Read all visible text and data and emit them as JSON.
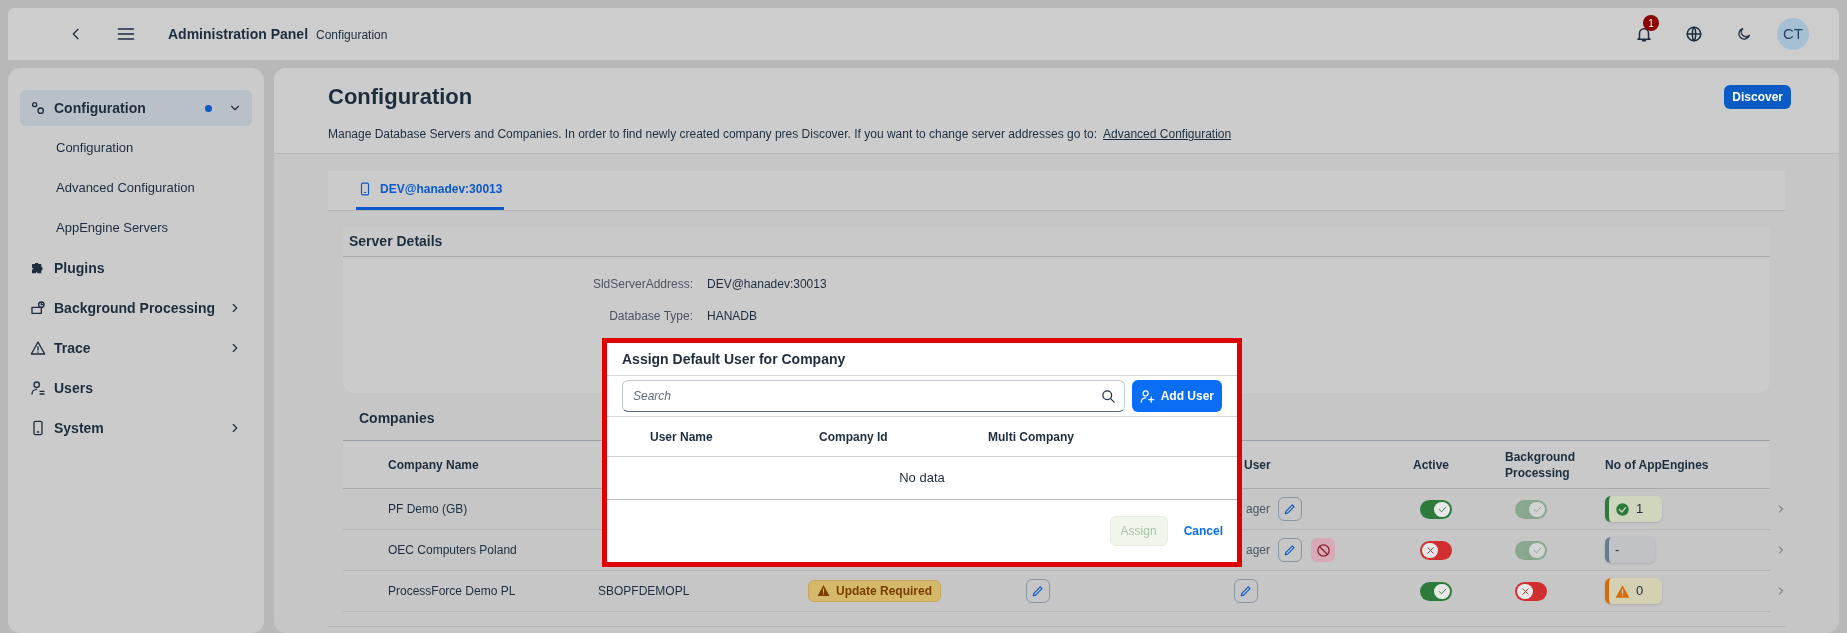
{
  "topbar": {
    "title": "Administration Panel",
    "subtitle": "Configuration",
    "notifications": "1",
    "avatar": "CT"
  },
  "sidebar": {
    "items": [
      {
        "label": "Configuration",
        "kind": "group",
        "expanded": true,
        "selected": true,
        "modified": true,
        "children": [
          {
            "label": "Configuration"
          },
          {
            "label": "Advanced Configuration"
          },
          {
            "label": "AppEngine Servers"
          }
        ]
      },
      {
        "label": "Plugins",
        "kind": "link",
        "selected": false,
        "modified": false
      },
      {
        "label": "Background Processing",
        "kind": "group",
        "expanded": false,
        "selected": false,
        "modified": false
      },
      {
        "label": "Trace",
        "kind": "group",
        "expanded": false,
        "selected": false,
        "modified": false
      },
      {
        "label": "Users",
        "kind": "link",
        "selected": false,
        "modified": false
      },
      {
        "label": "System",
        "kind": "group",
        "expanded": false,
        "selected": false,
        "modified": false
      }
    ]
  },
  "page": {
    "title": "Configuration",
    "discover_button": "Discover",
    "description": "Manage Database Servers and Companies. In order to find newly created company pres Discover. If you want to change server addresses go to:",
    "description_link": "Advanced Configuration"
  },
  "tabs": [
    {
      "label": "DEV@hanadev:30013",
      "selected": true
    }
  ],
  "server_details": {
    "title": "Server Details",
    "fields": [
      {
        "label": "SldServerAddress:",
        "value": "DEV@hanadev:30013"
      },
      {
        "label": "Database Type:",
        "value": "HANADB"
      }
    ]
  },
  "companies": {
    "title": "Companies",
    "columns": [
      "Company Name",
      "User",
      "Active",
      "Background Processing",
      "No of AppEngines"
    ],
    "rows": [
      {
        "name": "PF Demo (GB)",
        "default_user": "ager",
        "can_block": false,
        "active": true,
        "background": true,
        "background_disabled": true,
        "appengines": {
          "kind": "success",
          "count": "1"
        }
      },
      {
        "name": "OEC Computers Poland",
        "default_user": "ager",
        "can_block": true,
        "active": false,
        "background": true,
        "background_disabled": true,
        "appengines": {
          "kind": "none",
          "count": "-"
        }
      },
      {
        "name": "ProcessForce Demo PL",
        "code": "SBOPFDEMOPL",
        "status": "Update Required",
        "can_block": false,
        "active": true,
        "background": false,
        "background_disabled": false,
        "appengines": {
          "kind": "warning",
          "count": "0"
        }
      }
    ]
  },
  "dialog": {
    "title": "Assign Default User for Company",
    "search_placeholder": "Search",
    "add_button": "Add User",
    "columns": [
      "User Name",
      "Company Id",
      "Multi Company"
    ],
    "empty_text": "No data",
    "assign_button": {
      "label": "Assign",
      "disabled": true
    },
    "cancel_button": "Cancel"
  }
}
